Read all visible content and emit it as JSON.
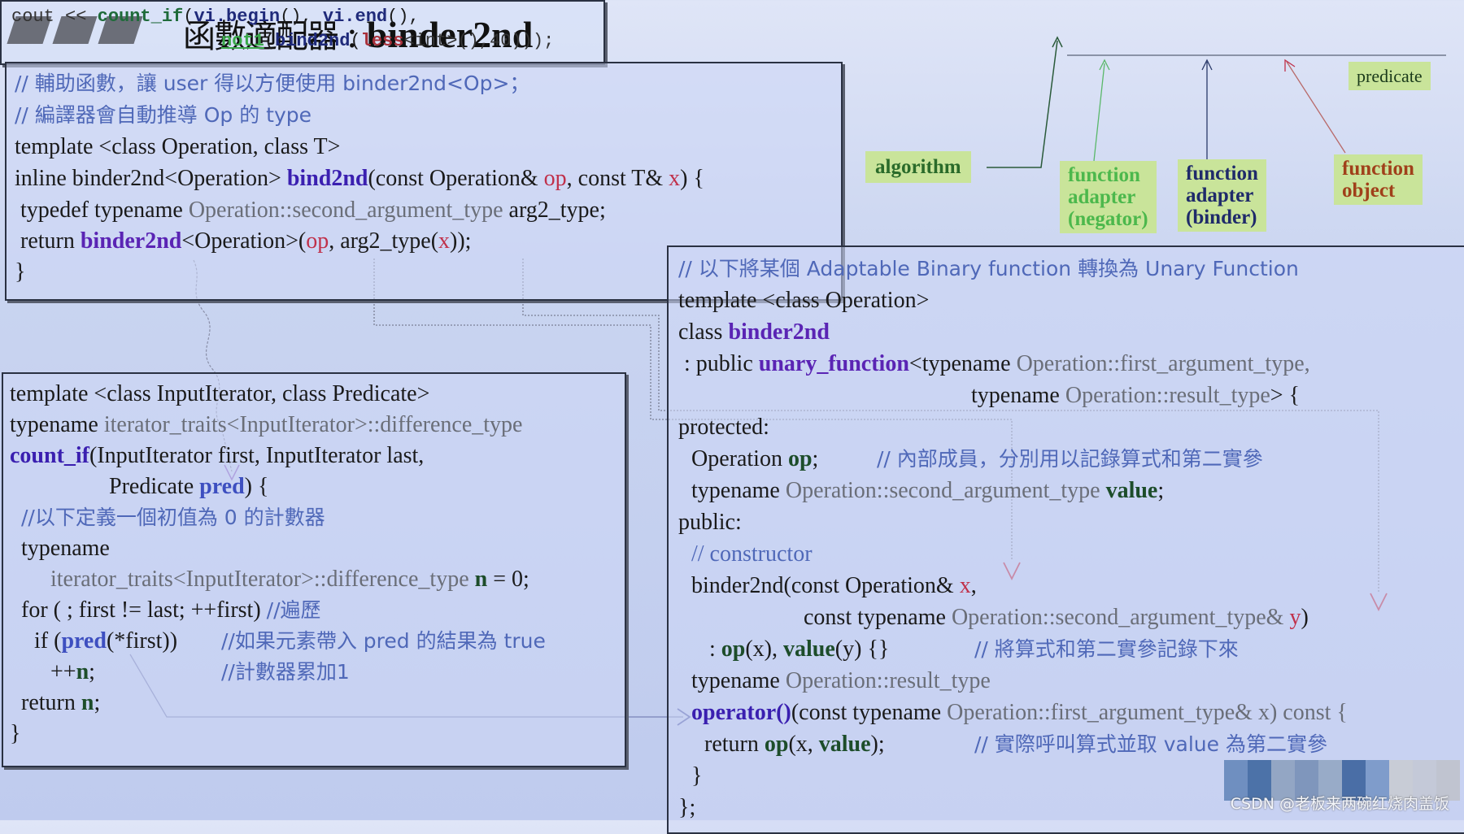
{
  "title": {
    "zh": "函數適配器",
    "sep": " : ",
    "en": "binder2nd"
  },
  "cout_box": {
    "line1": [
      "cout << ",
      "count_if",
      "(",
      "vi.begin",
      "(), ",
      "vi.end",
      "(),"
    ],
    "line2": [
      "not1",
      "(",
      "bind2nd",
      "(",
      "less",
      "<int>(),40)));"
    ]
  },
  "labels": {
    "predicate": "predicate",
    "algorithm": "algorithm",
    "negator": [
      "function",
      "adapter",
      "(negator)"
    ],
    "binder": [
      "function",
      "adapter",
      "(binder)"
    ],
    "function_object": [
      "function",
      "object"
    ]
  },
  "box_bind2nd": {
    "c1": "// 輔助函數，讓 user 得以方便使用 binder2nd<Op>；",
    "c2": "// 編譯器會自動推導 Op 的 type",
    "l3": "template <class Operation, class T>",
    "l4a": "inline binder2nd<Operation> ",
    "l4b": "bind2nd",
    "l4c": "(const Operation& ",
    "l4d": "op",
    "l4e": ", const T& ",
    "l4f": "x",
    "l4g": ") {",
    "l5a": " typedef typename ",
    "l5b": "Operation::second_argument_type",
    "l5c": " arg2_type;",
    "l6a": " return ",
    "l6b": "binder2nd",
    "l6c": "<Operation>(",
    "l6d": "op",
    "l6e": ", arg2_type(",
    "l6f": "x",
    "l6g": "));",
    "l7": "}"
  },
  "box_count_if": {
    "l1": "template <class InputIterator, class Predicate>",
    "l2a": "typename ",
    "l2b": "iterator_traits<InputIterator>::difference_type",
    "l3a": "count_if",
    "l3b": "(InputIterator first, InputIterator last,",
    "l4a": "Predicate ",
    "l4b": "pred",
    "l4c": ") {",
    "c5": "//以下定義一個初值為 0 的計數器",
    "l6": "typename",
    "l7a": "iterator_traits<InputIterator>::difference_type ",
    "l7b": "n",
    "l7c": " = 0;",
    "l8a": "for ( ; first != last; ++first) ",
    "l8b": "//遍歷",
    "l9a": "if (",
    "l9b": "pred",
    "l9c": "(*first))",
    "l9d": "//如果元素帶入 pred 的結果為 true",
    "l10a": "++",
    "l10b": "n",
    "l10c": ";",
    "l10d": "//計數器累加1",
    "l11a": "return ",
    "l11b": "n",
    "l11c": ";",
    "l12": "}"
  },
  "box_binder2nd": {
    "c1": "// 以下將某個 Adaptable Binary function 轉換為 Unary Function",
    "l2": "template <class Operation>",
    "l3a": "class ",
    "l3b": "binder2nd",
    "l4a": " : public ",
    "l4b": "unary_function",
    "l4c": "<typename ",
    "l4d": "Operation::first_argument_type,",
    "l5a": "typename ",
    "l5b": "Operation::result_type",
    "l5c": "> {",
    "l6": "protected:",
    "l7a": "Operation ",
    "l7b": "op",
    "l7c": ";",
    "l7d": "// 內部成員，分別用以記錄算式和第二實參",
    "l8a": "typename ",
    "l8b": "Operation::second_argument_type ",
    "l8c": "value",
    "l8d": ";",
    "l9": "public:",
    "l10": "// constructor",
    "l11a": "binder2nd(const Operation& ",
    "l11b": "x",
    "l11c": ",",
    "l12a": "const typename ",
    "l12b": "Operation::second_argument_type& ",
    "l12c": "y",
    "l12d": ")",
    "l13a": ": ",
    "l13b": "op",
    "l13c": "(x), ",
    "l13d": "value",
    "l13e": "(y) {}",
    "l13f": "// 將算式和第二實參記錄下來",
    "l14a": "typename ",
    "l14b": "Operation::result_type",
    "l15a": "operator()",
    "l15b": "(const typename ",
    "l15c": "Operation::first_argument_type& x) const {",
    "l16a": "return ",
    "l16b": "op",
    "l16c": "(x, ",
    "l16d": "value",
    "l16e": ");",
    "l16f": "// 實際呼叫算式並取 value 為第二實參",
    "l17": "}",
    "l18": "};"
  },
  "watermark": "CSDN @老板来两碗红烧肉盖饭",
  "colors": {
    "background": "#c9d4f0",
    "comment": "#4f68b8",
    "keyword_blue": "#3a1fb0",
    "highlight_red": "#c0304a",
    "tag_bg": "#c9e49a"
  }
}
